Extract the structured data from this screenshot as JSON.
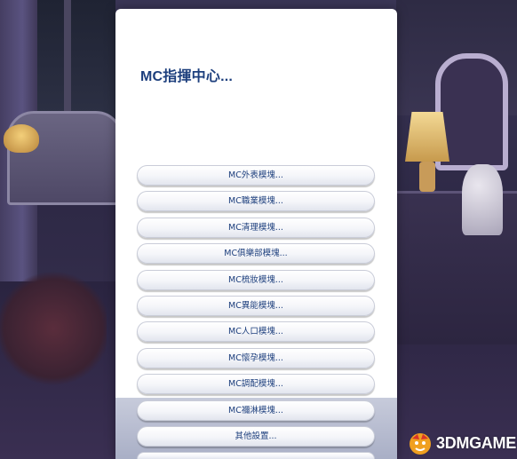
{
  "panel": {
    "title": "MC指揮中心..."
  },
  "menu": {
    "items": [
      {
        "label": "MC外表模塊..."
      },
      {
        "label": "MC職業模塊..."
      },
      {
        "label": "MC清理模塊..."
      },
      {
        "label": "MC俱樂部模塊..."
      },
      {
        "label": "MC梳妝模塊..."
      },
      {
        "label": "MC異能模塊..."
      },
      {
        "label": "MC人口模塊..."
      },
      {
        "label": "MC懷孕模塊..."
      },
      {
        "label": "MC調配模塊..."
      },
      {
        "label": "MC禰淋模塊..."
      },
      {
        "label": "其他設置..."
      }
    ]
  },
  "watermark": {
    "text": "3DMGAME",
    "logo_icon": "3dm-logo-icon",
    "colors": {
      "logo_orange": "#f0a020",
      "logo_red": "#d8342a"
    }
  },
  "colors": {
    "title": "#1d3f7d",
    "button_text": "#1d3f7d",
    "panel_bg": "#ffffff"
  }
}
